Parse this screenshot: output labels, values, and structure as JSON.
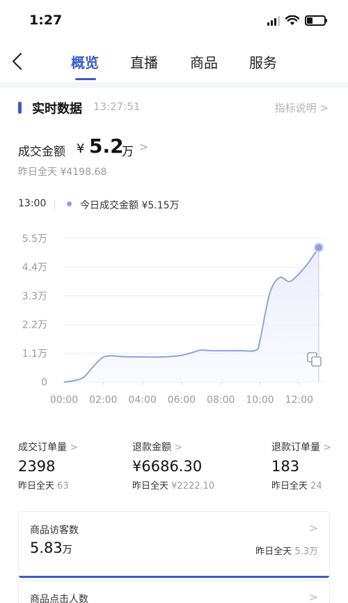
{
  "status_bar": {
    "time": "1:27"
  },
  "nav": {
    "tabs": [
      {
        "label": "概览",
        "active": true
      },
      {
        "label": "直播",
        "active": false
      },
      {
        "label": "商品",
        "active": false
      },
      {
        "label": "服务",
        "active": false
      }
    ]
  },
  "realtime": {
    "title": "实时数据",
    "timestamp": "13:27:51",
    "info_link": "指标说明 >"
  },
  "gmv": {
    "label": "成交金额",
    "currency": "¥",
    "value": "5.2",
    "unit": "万",
    "chevron": ">",
    "yesterday_label": "昨日全天",
    "yesterday_value": "¥4198.68"
  },
  "legend": {
    "time": "13:00",
    "series_label": "今日成交金额",
    "series_value": "¥5.15万"
  },
  "chart_data": {
    "type": "area",
    "x_labels": [
      "00:00",
      "02:00",
      "04:00",
      "06:00",
      "08:00",
      "10:00",
      "12:00"
    ],
    "y_labels": [
      "0",
      "1.1万",
      "2.2万",
      "3.3万",
      "4.4万",
      "5.5万"
    ],
    "ylim": [
      0,
      5.5
    ],
    "xlim": [
      0,
      13
    ],
    "grid": true,
    "series": [
      {
        "x": [
          0,
          0.5,
          1,
          1.5,
          2,
          2.5,
          3,
          4,
          5,
          6,
          6.5,
          7,
          7.5,
          8,
          9,
          9.8,
          10,
          10.5,
          11,
          11.5,
          12,
          12.5,
          13
        ],
        "y": [
          0,
          0.05,
          0.18,
          0.6,
          0.95,
          1.0,
          0.97,
          0.96,
          0.96,
          1.02,
          1.12,
          1.22,
          1.2,
          1.2,
          1.2,
          1.22,
          1.6,
          3.4,
          4.0,
          3.85,
          4.15,
          4.6,
          5.15
        ]
      }
    ],
    "accent_color": "#8ea4e0"
  },
  "metrics": [
    {
      "label": "成交订单量",
      "chevron": ">",
      "value": "2398",
      "yesterday_label": "昨日全天",
      "yesterday_value": "63"
    },
    {
      "label": "退款金额",
      "chevron": ">",
      "value": "¥6686.30",
      "yesterday_label": "昨日全天",
      "yesterday_value": "¥2222.10"
    },
    {
      "label": "退款订单量",
      "chevron": ">",
      "value": "183",
      "yesterday_label": "昨日全天",
      "yesterday_value": "24"
    }
  ],
  "visitors": {
    "label": "商品访客数",
    "chevron": ">",
    "value": "5.83",
    "unit": "万",
    "yesterday_label": "昨日全天",
    "yesterday_value": "5.3万"
  },
  "clicks": {
    "label": "商品点击人数",
    "chevron": ">"
  },
  "colors": {
    "accent": "#3a5cc8",
    "chart_line": "#8ea4e0"
  }
}
